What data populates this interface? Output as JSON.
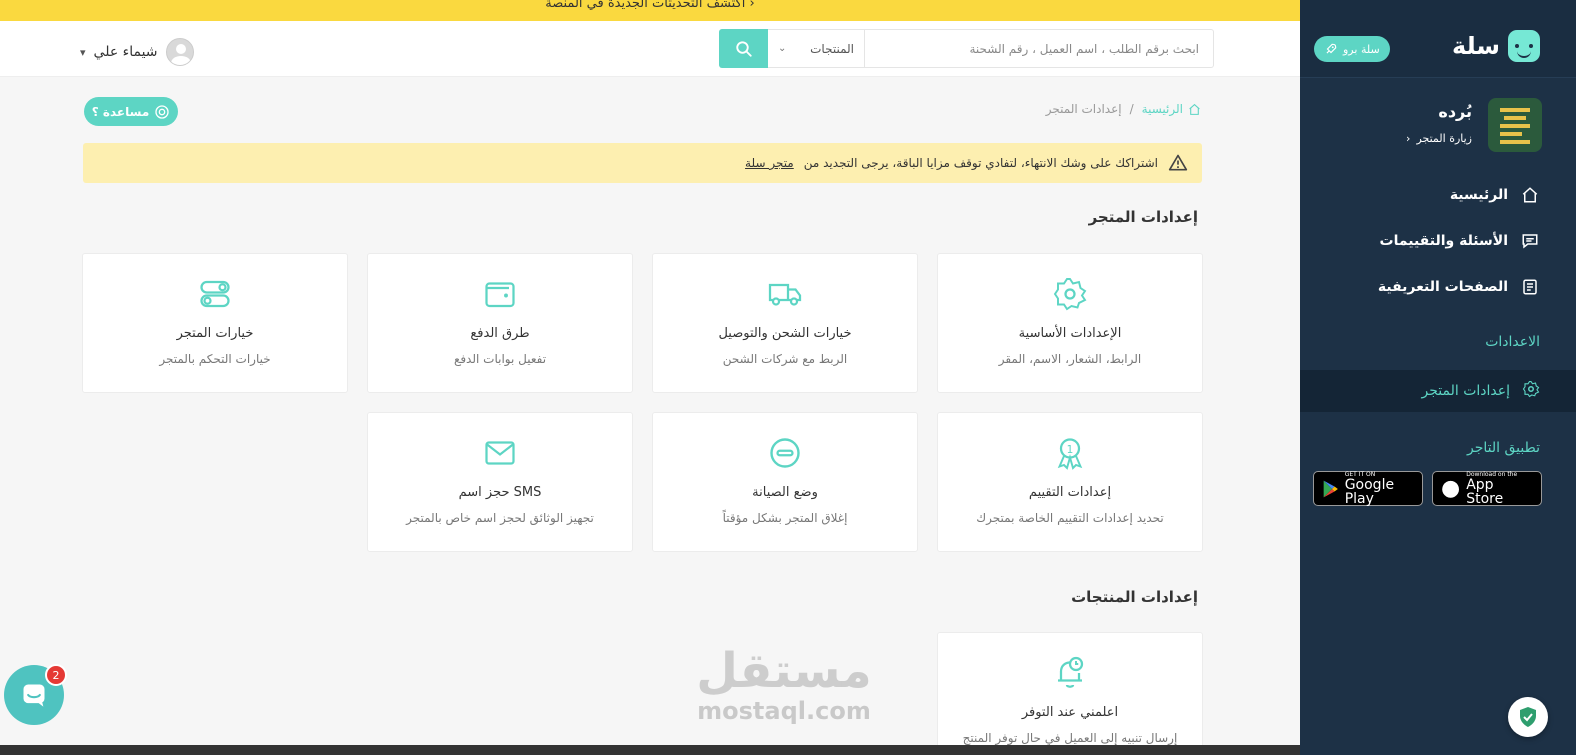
{
  "banner": {
    "text": "اكتشف التحديثات الجديدة في المنصة  ›"
  },
  "header": {
    "user_name": "شيماء علي",
    "search": {
      "placeholder": "ابحث برقم الطلب ، اسم العميل ، رقم الشحنة",
      "scope": "المنتجات"
    }
  },
  "sidebar": {
    "brand": "سلة",
    "pro_label": "سلة برو",
    "store_name": "بُرده",
    "store_visit": "زيارة المتجر",
    "nav": [
      {
        "label": "الرئيسية",
        "icon": "home-icon"
      },
      {
        "label": "الأسئلة والتقييمات",
        "icon": "comments-icon"
      },
      {
        "label": "الصفحات التعريفية",
        "icon": "pages-icon"
      }
    ],
    "section_settings": "الاعدادات",
    "active_item": "إعدادات المتجر",
    "app_title": "تطبيق التاجر",
    "google_play": {
      "small": "GET IT ON",
      "big": "Google Play"
    },
    "app_store": {
      "small": "Download on the",
      "big": "App Store"
    }
  },
  "main": {
    "help_label": "مساعدة ؟",
    "breadcrumb": {
      "home": "الرئيسية",
      "sep": "/",
      "current": "إعدادات المتجر"
    },
    "alert": {
      "text": "اشتراكك على وشك الانتهاء، لتفادي توقف مزايا الباقة، يرجى التجديد من",
      "link": "متجر سلة"
    },
    "store_settings_title": "إعدادات المتجر",
    "cards": [
      {
        "title": "الإعدادات الأساسية",
        "desc": "الرابط، الشعار، الاسم، المقر",
        "icon": "gear-icon"
      },
      {
        "title": "خيارات الشحن والتوصيل",
        "desc": "الربط مع شركات الشحن",
        "icon": "truck-icon"
      },
      {
        "title": "طرق الدفع",
        "desc": "تفعيل بوابات الدفع",
        "icon": "wallet-icon"
      },
      {
        "title": "خيارات المتجر",
        "desc": "خيارات التحكم بالمتجر",
        "icon": "toggles-icon"
      },
      {
        "title": "إعدادات التقييم",
        "desc": "تحديد إعدادات التقييم الخاصة بمتجرك",
        "icon": "award-icon"
      },
      {
        "title": "وضع الصيانة",
        "desc": "إغلاق المتجر بشكل مؤقتاً",
        "icon": "no-entry-icon"
      },
      {
        "title": "حجز اسم SMS",
        "desc": "تجهيز الوثائق لحجز اسم خاص بالمتجر",
        "icon": "envelope-icon"
      }
    ],
    "product_settings_title": "إعدادات المنتجات",
    "product_cards": [
      {
        "title": "اعلمني عند التوفر",
        "desc": "إرسال تنبيه إلى العميل في حال توفر المنتج",
        "icon": "bell-clock-icon"
      }
    ]
  },
  "watermark": {
    "ar": "مستقل",
    "en": "mostaql.com"
  },
  "chat": {
    "count": "2"
  },
  "colors": {
    "accent": "#5dd5c4",
    "sidebar": "#1d3146",
    "banner": "#fad93f",
    "alert": "#fdefb0"
  }
}
